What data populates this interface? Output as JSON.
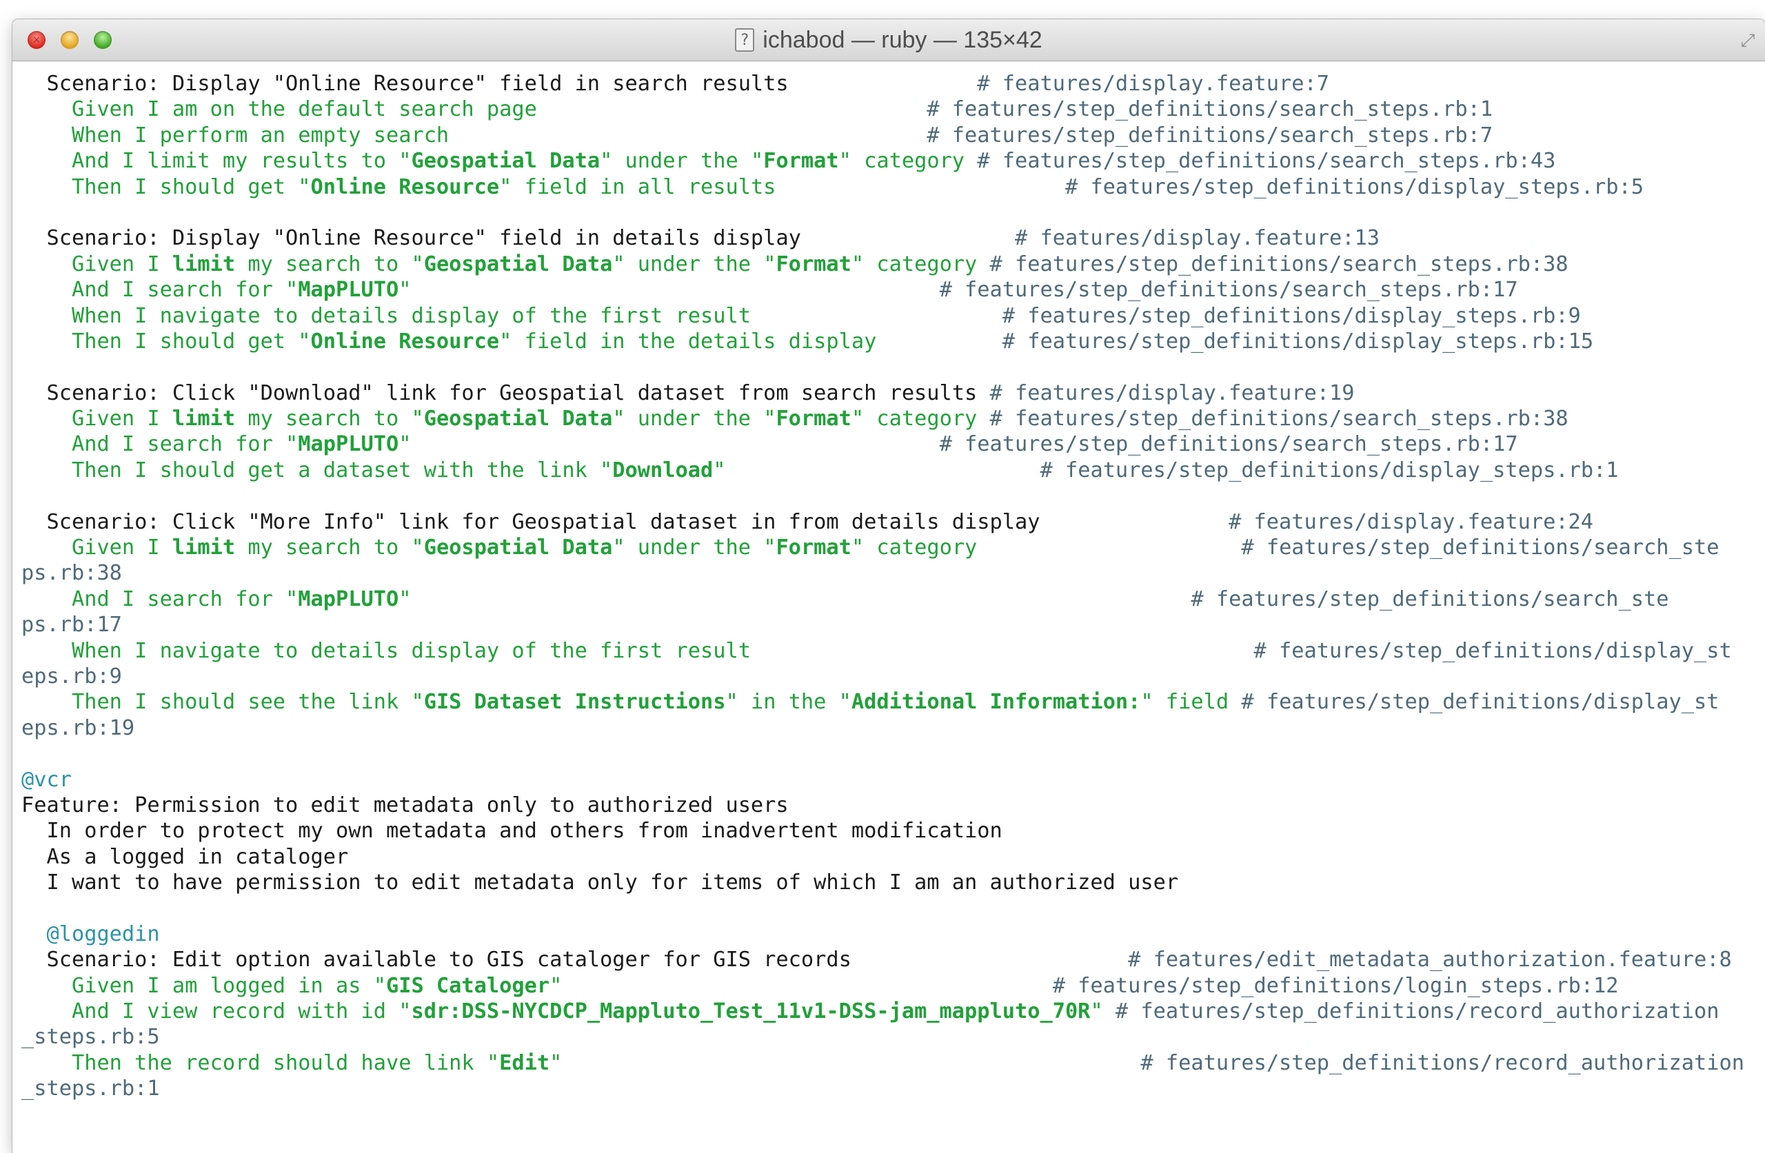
{
  "window": {
    "title": "ichabod — ruby — 135×42",
    "title_icon": "document-icon",
    "controls": [
      "close",
      "minimize",
      "zoom"
    ]
  },
  "colors": {
    "step_green": "#21a139",
    "comment_gray": "#4f6a79",
    "tag_teal": "#2b93a8",
    "text": "#1a1a1a"
  },
  "terminal": {
    "lines": [
      {
        "parts": [
          {
            "t": "  Scenario: Display \"Online Resource\" field in search results",
            "s": ""
          },
          {
            "t": "               # features/display.feature:7",
            "s": "c"
          }
        ]
      },
      {
        "parts": [
          {
            "t": "    Given I am on the default search page",
            "s": "g"
          },
          {
            "t": "                               # features/step_definitions/search_steps.rb:1",
            "s": "c"
          }
        ]
      },
      {
        "parts": [
          {
            "t": "    When I perform an empty search",
            "s": "g"
          },
          {
            "t": "                                      # features/step_definitions/search_steps.rb:7",
            "s": "c"
          }
        ]
      },
      {
        "parts": [
          {
            "t": "    And I limit my results to \"",
            "s": "g"
          },
          {
            "t": "Geospatial Data",
            "s": "g b"
          },
          {
            "t": "\" under the \"",
            "s": "g"
          },
          {
            "t": "Format",
            "s": "g b"
          },
          {
            "t": "\" category",
            "s": "g"
          },
          {
            "t": " # features/step_definitions/search_steps.rb:43",
            "s": "c"
          }
        ]
      },
      {
        "parts": [
          {
            "t": "    Then I should get \"",
            "s": "g"
          },
          {
            "t": "Online Resource",
            "s": "g b"
          },
          {
            "t": "\" field in all results",
            "s": "g"
          },
          {
            "t": "                       # features/step_definitions/display_steps.rb:5",
            "s": "c"
          }
        ]
      },
      {
        "parts": [
          {
            "t": "",
            "s": ""
          }
        ]
      },
      {
        "parts": [
          {
            "t": "  Scenario: Display \"Online Resource\" field in details display",
            "s": ""
          },
          {
            "t": "                 # features/display.feature:13",
            "s": "c"
          }
        ]
      },
      {
        "parts": [
          {
            "t": "    Given I ",
            "s": "g"
          },
          {
            "t": "limit",
            "s": "g b"
          },
          {
            "t": " my search to \"",
            "s": "g"
          },
          {
            "t": "Geospatial Data",
            "s": "g b"
          },
          {
            "t": "\" under the \"",
            "s": "g"
          },
          {
            "t": "Format",
            "s": "g b"
          },
          {
            "t": "\" category",
            "s": "g"
          },
          {
            "t": " # features/step_definitions/search_steps.rb:38",
            "s": "c"
          }
        ]
      },
      {
        "parts": [
          {
            "t": "    And I search for \"",
            "s": "g"
          },
          {
            "t": "MapPLUTO",
            "s": "g b"
          },
          {
            "t": "\"",
            "s": "g"
          },
          {
            "t": "                                          # features/step_definitions/search_steps.rb:17",
            "s": "c"
          }
        ]
      },
      {
        "parts": [
          {
            "t": "    When I navigate to details display of the first result",
            "s": "g"
          },
          {
            "t": "                    # features/step_definitions/display_steps.rb:9",
            "s": "c"
          }
        ]
      },
      {
        "parts": [
          {
            "t": "    Then I should get \"",
            "s": "g"
          },
          {
            "t": "Online Resource",
            "s": "g b"
          },
          {
            "t": "\" field in the details display",
            "s": "g"
          },
          {
            "t": "          # features/step_definitions/display_steps.rb:15",
            "s": "c"
          }
        ]
      },
      {
        "parts": [
          {
            "t": "",
            "s": ""
          }
        ]
      },
      {
        "parts": [
          {
            "t": "  Scenario: Click \"Download\" link for Geospatial dataset from search results",
            "s": ""
          },
          {
            "t": " # features/display.feature:19",
            "s": "c"
          }
        ]
      },
      {
        "parts": [
          {
            "t": "    Given I ",
            "s": "g"
          },
          {
            "t": "limit",
            "s": "g b"
          },
          {
            "t": " my search to \"",
            "s": "g"
          },
          {
            "t": "Geospatial Data",
            "s": "g b"
          },
          {
            "t": "\" under the \"",
            "s": "g"
          },
          {
            "t": "Format",
            "s": "g b"
          },
          {
            "t": "\" category",
            "s": "g"
          },
          {
            "t": " # features/step_definitions/search_steps.rb:38",
            "s": "c"
          }
        ]
      },
      {
        "parts": [
          {
            "t": "    And I search for \"",
            "s": "g"
          },
          {
            "t": "MapPLUTO",
            "s": "g b"
          },
          {
            "t": "\"",
            "s": "g"
          },
          {
            "t": "                                          # features/step_definitions/search_steps.rb:17",
            "s": "c"
          }
        ]
      },
      {
        "parts": [
          {
            "t": "    Then I should get a dataset with the link \"",
            "s": "g"
          },
          {
            "t": "Download",
            "s": "g b"
          },
          {
            "t": "\"",
            "s": "g"
          },
          {
            "t": "                         # features/step_definitions/display_steps.rb:1",
            "s": "c"
          }
        ]
      },
      {
        "parts": [
          {
            "t": "",
            "s": ""
          }
        ]
      },
      {
        "parts": [
          {
            "t": "  Scenario: Click \"More Info\" link for Geospatial dataset in from details display",
            "s": ""
          },
          {
            "t": "               # features/display.feature:24",
            "s": "c"
          }
        ]
      },
      {
        "parts": [
          {
            "t": "    Given I ",
            "s": "g"
          },
          {
            "t": "limit",
            "s": "g b"
          },
          {
            "t": " my search to \"",
            "s": "g"
          },
          {
            "t": "Geospatial Data",
            "s": "g b"
          },
          {
            "t": "\" under the \"",
            "s": "g"
          },
          {
            "t": "Format",
            "s": "g b"
          },
          {
            "t": "\" category",
            "s": "g"
          },
          {
            "t": "                     # features/step_definitions/search_ste",
            "s": "c"
          }
        ]
      },
      {
        "parts": [
          {
            "t": "ps.rb:38",
            "s": "c"
          }
        ]
      },
      {
        "parts": [
          {
            "t": "    And I search for \"",
            "s": "g"
          },
          {
            "t": "MapPLUTO",
            "s": "g b"
          },
          {
            "t": "\"",
            "s": "g"
          },
          {
            "t": "                                                              # features/step_definitions/search_ste",
            "s": "c"
          }
        ]
      },
      {
        "parts": [
          {
            "t": "ps.rb:17",
            "s": "c"
          }
        ]
      },
      {
        "parts": [
          {
            "t": "    When I navigate to details display of the first result",
            "s": "g"
          },
          {
            "t": "                                        # features/step_definitions/display_st",
            "s": "c"
          }
        ]
      },
      {
        "parts": [
          {
            "t": "eps.rb:9",
            "s": "c"
          }
        ]
      },
      {
        "parts": [
          {
            "t": "    Then I should see the link \"",
            "s": "g"
          },
          {
            "t": "GIS Dataset Instructions",
            "s": "g b"
          },
          {
            "t": "\" in the \"",
            "s": "g"
          },
          {
            "t": "Additional Information:",
            "s": "g b"
          },
          {
            "t": "\" field",
            "s": "g"
          },
          {
            "t": " # features/step_definitions/display_st",
            "s": "c"
          }
        ]
      },
      {
        "parts": [
          {
            "t": "eps.rb:19",
            "s": "c"
          }
        ]
      },
      {
        "parts": [
          {
            "t": "",
            "s": ""
          }
        ]
      },
      {
        "parts": [
          {
            "t": "@vcr",
            "s": "t"
          }
        ]
      },
      {
        "parts": [
          {
            "t": "Feature: Permission to edit metadata only to authorized users",
            "s": ""
          }
        ]
      },
      {
        "parts": [
          {
            "t": "  In order to protect my own metadata and others from inadvertent modification",
            "s": ""
          }
        ]
      },
      {
        "parts": [
          {
            "t": "  As a logged in cataloger",
            "s": ""
          }
        ]
      },
      {
        "parts": [
          {
            "t": "  I want to have permission to edit metadata only for items of which I am an authorized user",
            "s": ""
          }
        ]
      },
      {
        "parts": [
          {
            "t": "",
            "s": ""
          }
        ]
      },
      {
        "parts": [
          {
            "t": "  @loggedin",
            "s": "t"
          }
        ]
      },
      {
        "parts": [
          {
            "t": "  Scenario: Edit option available to GIS cataloger for GIS records",
            "s": ""
          },
          {
            "t": "                      # features/edit_metadata_authorization.feature:8",
            "s": "c"
          }
        ]
      },
      {
        "parts": [
          {
            "t": "    Given I am logged in as \"",
            "s": "g"
          },
          {
            "t": "GIS Cataloger",
            "s": "g b"
          },
          {
            "t": "\"",
            "s": "g"
          },
          {
            "t": "                                       # features/step_definitions/login_steps.rb:12",
            "s": "c"
          }
        ]
      },
      {
        "parts": [
          {
            "t": "    And I view record with id \"",
            "s": "g"
          },
          {
            "t": "sdr:DSS-NYCDCP_Mappluto_Test_11v1-DSS-jam_mappluto_70R",
            "s": "g b"
          },
          {
            "t": "\"",
            "s": "g"
          },
          {
            "t": " # features/step_definitions/record_authorization",
            "s": "c"
          }
        ]
      },
      {
        "parts": [
          {
            "t": "_steps.rb:5",
            "s": "c"
          }
        ]
      },
      {
        "parts": [
          {
            "t": "    Then the record should have link \"",
            "s": "g"
          },
          {
            "t": "Edit",
            "s": "g b"
          },
          {
            "t": "\"",
            "s": "g"
          },
          {
            "t": "                                              # features/step_definitions/record_authorization",
            "s": "c"
          }
        ]
      },
      {
        "parts": [
          {
            "t": "_steps.rb:1",
            "s": "c"
          }
        ]
      }
    ]
  }
}
